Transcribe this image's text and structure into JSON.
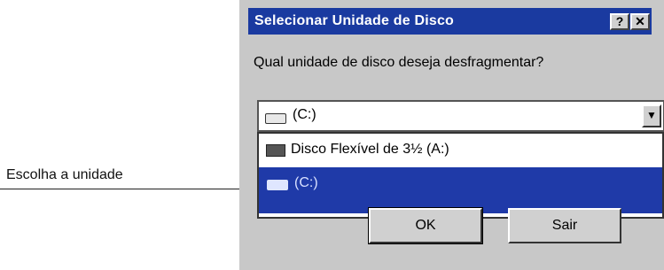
{
  "callout": {
    "label": "Escolha a unidade"
  },
  "dialog": {
    "title": "Selecionar Unidade de Disco",
    "help_glyph": "?",
    "close_glyph": "✕",
    "question": "Qual unidade de disco deseja desfragmentar?",
    "combo": {
      "selected": "(C:)",
      "arrow": "▼"
    },
    "options": [
      {
        "label": "Disco Flexível de 3½ (A:)",
        "icon": "floppy-drive-icon"
      },
      {
        "label": "(C:)",
        "icon": "hard-drive-icon",
        "highlighted": true
      }
    ],
    "ok_label": "OK",
    "exit_label": "Sair"
  },
  "colors": {
    "titlebar": "#1a3aa0",
    "highlight": "#1f3aa8",
    "face": "#c8c8c8"
  }
}
